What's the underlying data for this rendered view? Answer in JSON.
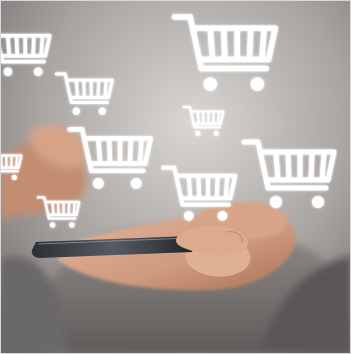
{
  "scene": {
    "subject": "hands-holding-smartphone",
    "icon": "shopping-cart-icon",
    "colors": {
      "background_light": "#c9c6c4",
      "background_dark": "#6f6c6b",
      "sweater": "#8e8a88",
      "skin": "#d8a98e",
      "skin_shadow": "#b9826a",
      "phone": "#1f2328",
      "cart": "#ffffff"
    }
  }
}
